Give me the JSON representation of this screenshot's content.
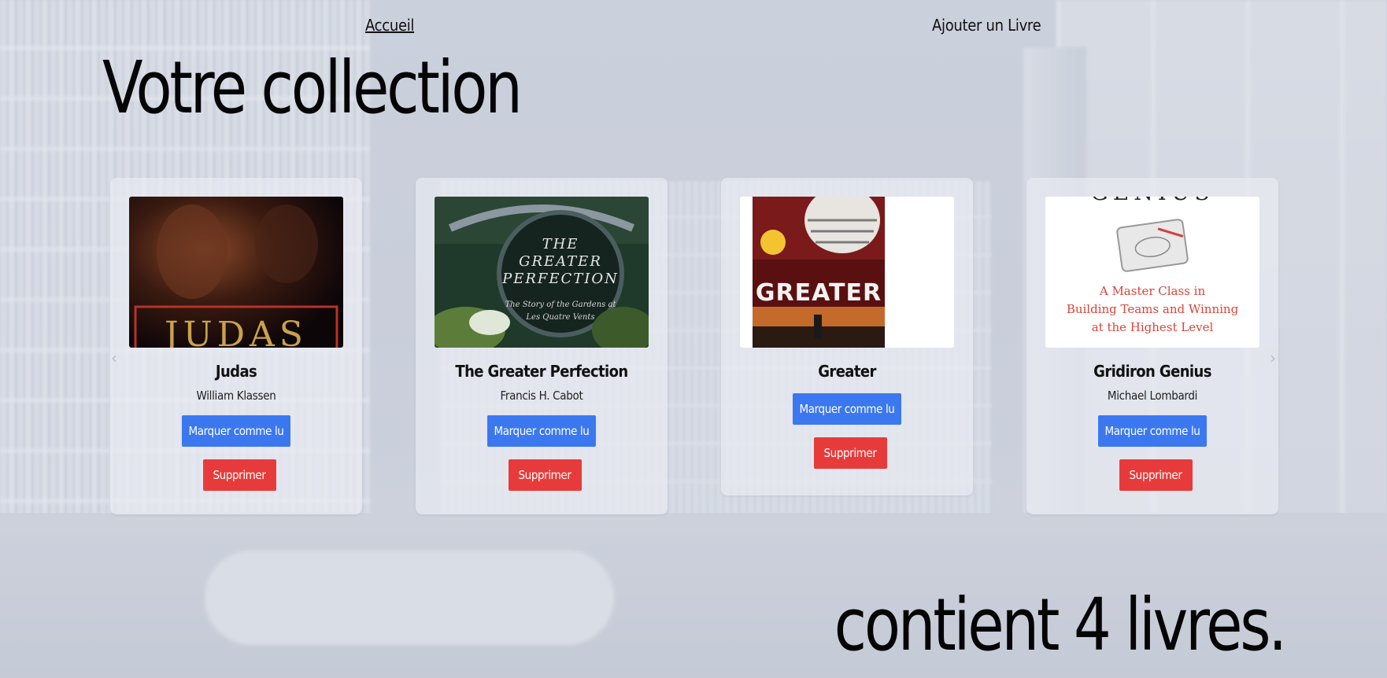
{
  "nav": {
    "home_label": "Accueil",
    "add_label": "Ajouter un Livre"
  },
  "header": {
    "title": "Votre collection",
    "count_text": "contient 4 livres."
  },
  "carousel": {
    "prev_icon": "chevron-left-icon",
    "next_icon": "chevron-right-icon"
  },
  "books": [
    {
      "title": "Judas",
      "author": "William Klassen",
      "cover_text": "JUDAS",
      "read_label": "Marquer comme lu",
      "delete_label": "Supprimer"
    },
    {
      "title": "The Greater Perfection",
      "author": "Francis H. Cabot",
      "cover_text": "THE GREATER PERFECTION",
      "cover_subtitle": "The Story of the Gardens at Les Quatre Vents",
      "read_label": "Marquer comme lu",
      "delete_label": "Supprimer"
    },
    {
      "title": "Greater",
      "author": "",
      "cover_text": "GREATER",
      "read_label": "Marquer comme lu",
      "delete_label": "Supprimer"
    },
    {
      "title": "Gridiron Genius",
      "author": "Michael Lombardi",
      "cover_text": "GENIUS",
      "cover_subtitle": "A Master Class in Building Teams and Winning at the Highest Level",
      "read_label": "Marquer comme lu",
      "delete_label": "Supprimer"
    }
  ],
  "colors": {
    "read_button": "#3b78f0",
    "delete_button": "#e73b3b"
  }
}
